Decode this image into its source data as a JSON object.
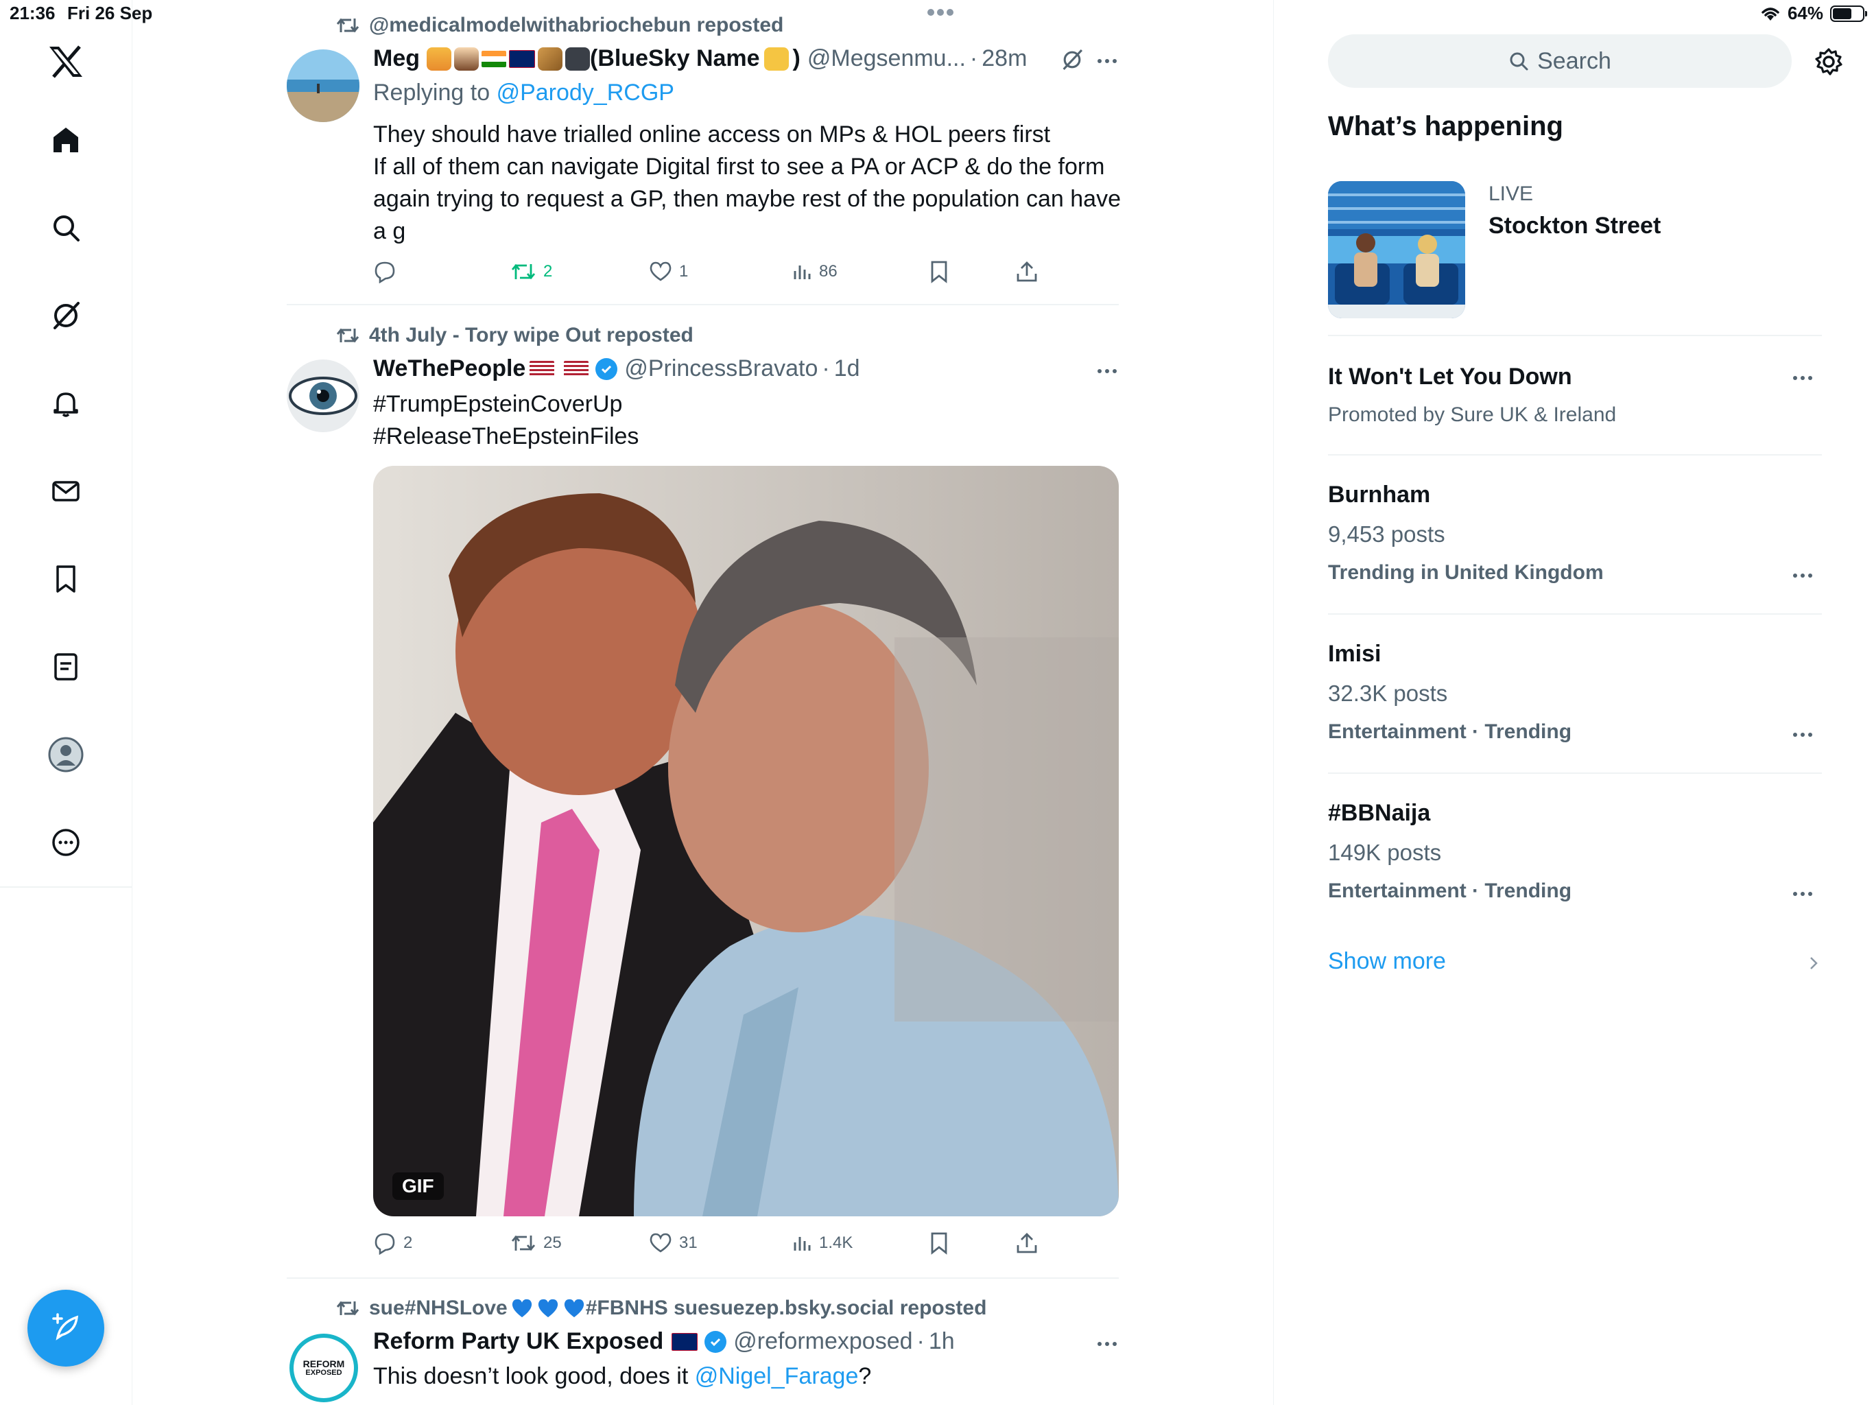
{
  "status_bar": {
    "time": "21:36",
    "date": "Fri 26 Sep",
    "battery": "64%",
    "battery_level": 0.64
  },
  "nav": {
    "items": [
      "x-logo",
      "home-icon",
      "search-icon",
      "grok-icon",
      "notifications-icon",
      "messages-icon",
      "bookmarks-icon",
      "lists-icon",
      "profile-icon",
      "more-icon"
    ],
    "compose": "compose-icon"
  },
  "feed": {
    "tweets": [
      {
        "reposted_by": "@medicalmodelwithabriochebun reposted",
        "name": "Meg",
        "name_suffix": "(BlueSky Name",
        "name_suffix_end": ")",
        "handle": "@Megsenmu...",
        "time": "28m",
        "replying_to_label": "Replying to",
        "replying_to": "@Parody_RCGP",
        "text": "They should have trialled online access on MPs & HOL peers first\nIf all of them can navigate Digital first to see a PA or ACP & do the form again trying to request a GP, then maybe rest of the population can have a g",
        "stats": {
          "replies": "",
          "reposts": "2",
          "likes": "1",
          "views": "86"
        }
      },
      {
        "reposted_by": "4th July - Tory wipe Out reposted",
        "name": "WeThePeople",
        "handle": "@PrincessBravato",
        "time": "1d",
        "hashtags": [
          "#TrumpEpsteinCoverUp",
          "#ReleaseTheEpsteinFiles"
        ],
        "media_badge": "GIF",
        "stats": {
          "replies": "2",
          "reposts": "25",
          "likes": "31",
          "views": "1.4K"
        }
      },
      {
        "reposted_by": "sue#NHSLove",
        "reposted_by_end": "#FBNHS suesuezep.bsky.social reposted",
        "name": "Reform Party UK Exposed",
        "handle": "@reformexposed",
        "time": "1h",
        "text_before": "This doesn’t look good, does it ",
        "mention": "@Nigel_Farage",
        "text_after": "?",
        "avatar_text_1": "REFORM",
        "avatar_text_2": "EXPOSED"
      }
    ]
  },
  "sidebar": {
    "search_placeholder": "Search",
    "whats_happening": "What’s happening",
    "live": {
      "label": "LIVE",
      "title": "Stockton Street"
    },
    "trends": [
      {
        "title": "It Won't Let You Down",
        "meta": "Promoted by Sure UK & Ireland"
      },
      {
        "title": "Burnham",
        "count": "9,453 posts",
        "context": "Trending in United Kingdom"
      },
      {
        "title": "Imisi",
        "count": "32.3K posts",
        "context": "Entertainment · Trending"
      },
      {
        "title": "#BBNaija",
        "count": "149K posts",
        "context": "Entertainment · Trending"
      }
    ],
    "show_more": "Show more"
  },
  "colors": {
    "accent": "#1d9bf0",
    "repost_green": "#00ba7c",
    "secondary_text": "#536471"
  }
}
